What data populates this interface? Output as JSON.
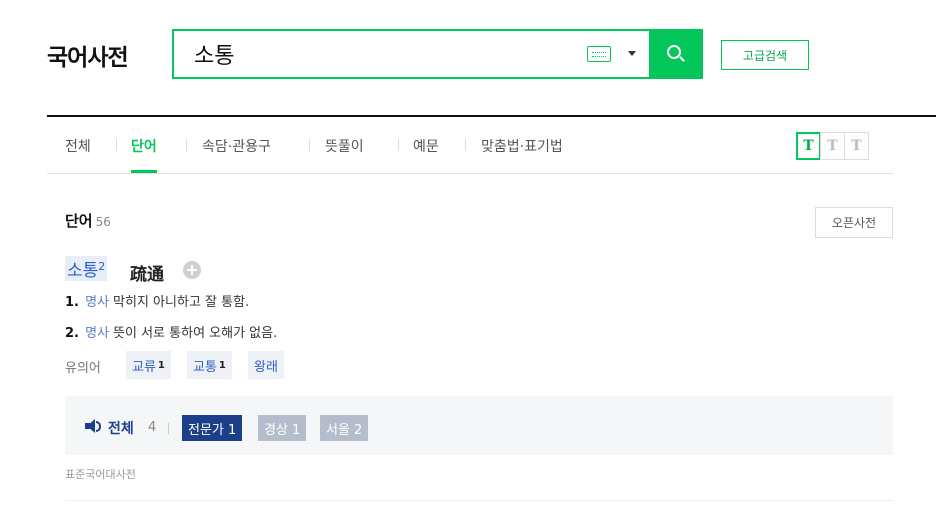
{
  "logo": "국어사전",
  "search": {
    "value": "소통",
    "advanced_label": "고급검색"
  },
  "tabs": [
    {
      "label": "전체"
    },
    {
      "label": "단어"
    },
    {
      "label": "속담·관용구"
    },
    {
      "label": "뜻풀이"
    },
    {
      "label": "예문"
    },
    {
      "label": "맞춤법·표기법"
    }
  ],
  "active_tab": "단어",
  "font_size_controls": [
    "T",
    "T",
    "T"
  ],
  "section": {
    "title": "단어",
    "count": "56",
    "open_dict_label": "오픈사전"
  },
  "entry": {
    "word": "소통",
    "homonym_number": "2",
    "hanja": "疏通",
    "definitions": [
      {
        "num": "1.",
        "pos": "명사",
        "text": "막히지 아니하고 잘 통함."
      },
      {
        "num": "2.",
        "pos": "명사",
        "text": "뜻이 서로 통하여 오해가 없음."
      }
    ],
    "synonym_label": "유의어",
    "synonyms": [
      {
        "word": "교류",
        "num": "1"
      },
      {
        "word": "교통",
        "num": "1"
      },
      {
        "word": "왕래",
        "num": ""
      }
    ],
    "audio": {
      "all_label": "전체",
      "all_count": "4",
      "chips": [
        {
          "label": "전문가 1"
        },
        {
          "label": "경상 1"
        },
        {
          "label": "서울 2"
        }
      ]
    },
    "source": "표준국어대사전"
  },
  "colors": {
    "accent": "#03c75a",
    "link": "#2c5fc5",
    "audio_active": "#1c3f8a"
  }
}
